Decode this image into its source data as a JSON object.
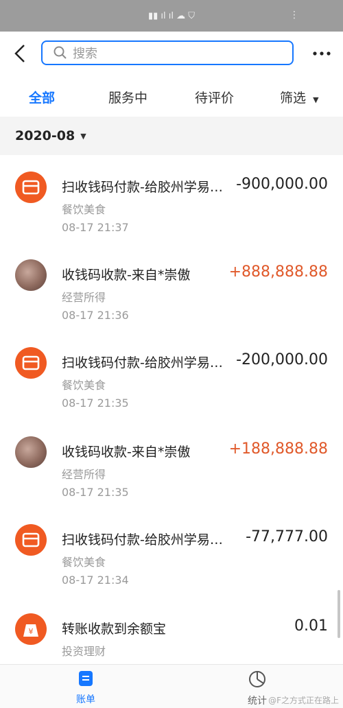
{
  "search": {
    "placeholder": "搜索"
  },
  "tabs": [
    "全部",
    "服务中",
    "待评价",
    "筛选"
  ],
  "month": "2020-08",
  "records": [
    {
      "title": "扫收钱码付款-给胶州学易…",
      "amount": "-900,000.00",
      "category": "餐饮美食",
      "time": "08-17  21:37",
      "avatar": "shop-icon",
      "positive": false
    },
    {
      "title": "收钱码收款-来自*崇傲",
      "amount": "+888,888.88",
      "category": "经营所得",
      "time": "08-17  21:36",
      "avatar": "user-photo",
      "positive": true
    },
    {
      "title": "扫收钱码付款-给胶州学易…",
      "amount": "-200,000.00",
      "category": "餐饮美食",
      "time": "08-17  21:35",
      "avatar": "shop-icon",
      "positive": false
    },
    {
      "title": "收钱码收款-来自*崇傲",
      "amount": "+188,888.88",
      "category": "经营所得",
      "time": "08-17  21:35",
      "avatar": "user-photo",
      "positive": true
    },
    {
      "title": "扫收钱码付款-给胶州学易…",
      "amount": "-77,777.00",
      "category": "餐饮美食",
      "time": "08-17  21:34",
      "avatar": "shop-icon",
      "positive": false
    },
    {
      "title": "转账收款到余额宝",
      "amount": "0.01",
      "category": "投资理财",
      "time": "",
      "avatar": "yuebao-icon",
      "positive": false
    }
  ],
  "bottom_nav": {
    "bill": "账单",
    "stats": "统计"
  },
  "watermark": "@F之方式正在路上",
  "colors": {
    "accent": "#1677ff",
    "positive": "#e0592a",
    "shop": "#f05a22"
  }
}
